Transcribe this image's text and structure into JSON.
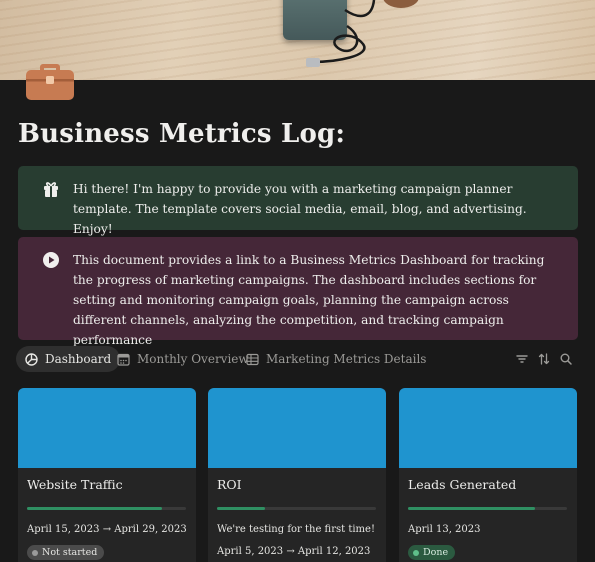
{
  "page": {
    "title": "Business Metrics Log:"
  },
  "callouts": [
    {
      "icon": "gift-icon",
      "text": "Hi there! I'm happy to provide you with a marketing campaign planner template. The template covers social media, email, blog, and advertising. Enjoy!",
      "color": "#283d31"
    },
    {
      "icon": "play-icon",
      "text": "This document provides a link to a Business Metrics Dashboard for tracking the progress of marketing campaigns. The dashboard includes sections for setting and monitoring campaign goals, planning the campaign across different channels, analyzing the competition, and tracking campaign performance",
      "color": "#452738"
    }
  ],
  "views": {
    "tabs": [
      {
        "label": "Dashboard",
        "icon": "chart-pie-icon",
        "active": true
      },
      {
        "label": "Monthly Overview",
        "icon": "calendar-icon",
        "active": false
      },
      {
        "label": "Marketing Metrics Details",
        "icon": "table-icon",
        "active": false
      }
    ],
    "tools": [
      "filter-icon",
      "sort-icon",
      "search-icon"
    ]
  },
  "cards": [
    {
      "name": "Website Traffic",
      "progress": 0.85,
      "date": "April 15, 2023 → April 29, 2023",
      "status": "Not started"
    },
    {
      "name": "ROI",
      "progress": 0.3,
      "note": "We're testing for the first time!",
      "date": "April 5, 2023 → April 12, 2023"
    },
    {
      "name": "Leads Generated",
      "progress": 0.8,
      "date": "April 13, 2023",
      "status": "Done"
    }
  ],
  "colors": {
    "card_cover": "#1f94cf",
    "progress": "#2f8f62",
    "background": "#191919"
  }
}
